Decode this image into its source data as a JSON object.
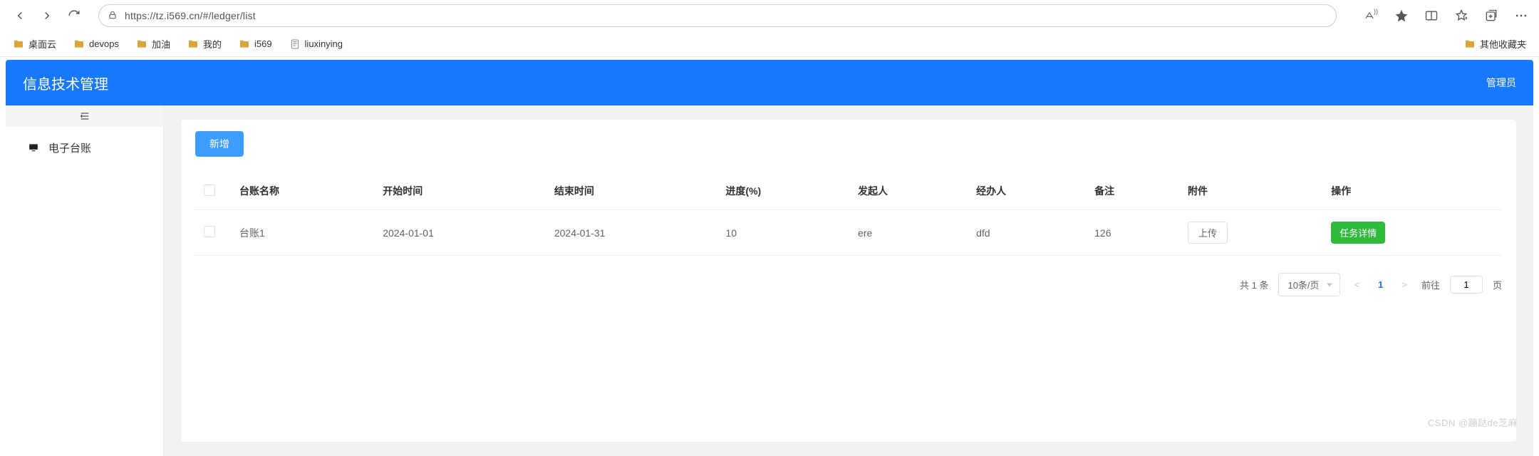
{
  "browser": {
    "url": "https://tz.i569.cn/#/ledger/list",
    "bookmarks": [
      "桌面云",
      "devops",
      "加油",
      "我的",
      "i569",
      "liuxinying"
    ],
    "other_bookmarks": "其他收藏夹"
  },
  "header": {
    "title": "信息技术管理",
    "admin": "管理员"
  },
  "sidebar": {
    "item_label": "电子台账"
  },
  "toolbar": {
    "add_label": "新增"
  },
  "table": {
    "headers": {
      "name": "台账名称",
      "start": "开始时间",
      "end": "结束时间",
      "progress": "进度(%)",
      "initiator": "发起人",
      "handler": "经办人",
      "remark": "备注",
      "attachment": "附件",
      "action": "操作"
    },
    "rows": [
      {
        "name": "台账1",
        "start": "2024-01-01",
        "end": "2024-01-31",
        "progress": "10",
        "initiator": "ere",
        "handler": "dfd",
        "remark": "126",
        "upload_label": "上传",
        "detail_label": "任务详情"
      }
    ]
  },
  "pagination": {
    "total_text": "共 1 条",
    "page_size_label": "10条/页",
    "current": "1",
    "goto_label": "前往",
    "goto_value": "1",
    "page_suffix": "页"
  },
  "watermark": "CSDN @蹦跶de芝麻"
}
